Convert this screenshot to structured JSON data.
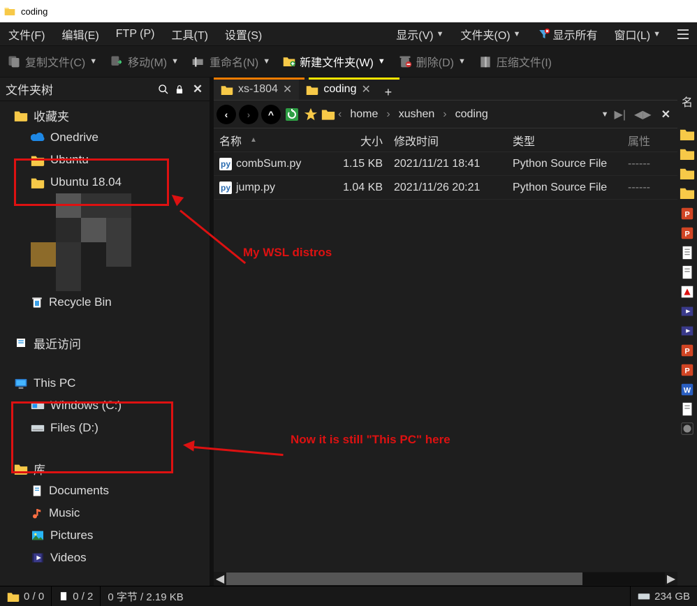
{
  "title": "coding",
  "menu": {
    "file": "文件(F)",
    "edit": "编辑(E)",
    "ftp": "FTP (P)",
    "tools": "工具(T)",
    "settings": "设置(S)",
    "view": "显示(V)",
    "folders": "文件夹(O)",
    "show_all": "显示所有",
    "window": "窗口(L)"
  },
  "toolbar": {
    "copy": "复制文件(C)",
    "move": "移动(M)",
    "rename": "重命名(N)",
    "new_folder": "新建文件夹(W)",
    "delete": "删除(D)",
    "compress": "压缩文件(I)"
  },
  "tree": {
    "header": "文件夹树",
    "favorites": "收藏夹",
    "onedrive": "Onedrive",
    "ubuntu": "Ubuntu",
    "ubuntu1804": "Ubuntu 18.04",
    "recycle": "Recycle Bin",
    "recent": "最近访问",
    "this_pc": "This PC",
    "drive_c": "Windows (C:)",
    "drive_d": "Files (D:)",
    "libraries": "库",
    "lib_docs": "Documents",
    "lib_music": "Music",
    "lib_pics": "Pictures",
    "lib_videos": "Videos"
  },
  "annotations": {
    "wsl": "My WSL distros",
    "this_pc": "Now it is still \"This PC\" here"
  },
  "tabs": {
    "tab1": "xs-1804",
    "tab2": "coding"
  },
  "breadcrumb": [
    "home",
    "xushen",
    "coding"
  ],
  "columns": {
    "name": "名称",
    "size": "大小",
    "mtime": "修改时间",
    "type": "类型",
    "attr": "属性"
  },
  "right_col_header": "名",
  "files": [
    {
      "name": "combSum.py",
      "size": "1.15 KB",
      "mtime": "2021/11/21 18:41",
      "type": "Python Source File",
      "attr": "------"
    },
    {
      "name": "jump.py",
      "size": "1.04 KB",
      "mtime": "2021/11/26 20:21",
      "type": "Python Source File",
      "attr": "------"
    }
  ],
  "status": {
    "seg1": "0 / 0",
    "seg2": "0 / 2",
    "seg3": "0 字节 / 2.19 KB",
    "seg4": "234 GB"
  },
  "colors": {
    "accent_orange": "#f57c00",
    "accent_yellow": "#ffe600",
    "annot_red": "#d11"
  }
}
